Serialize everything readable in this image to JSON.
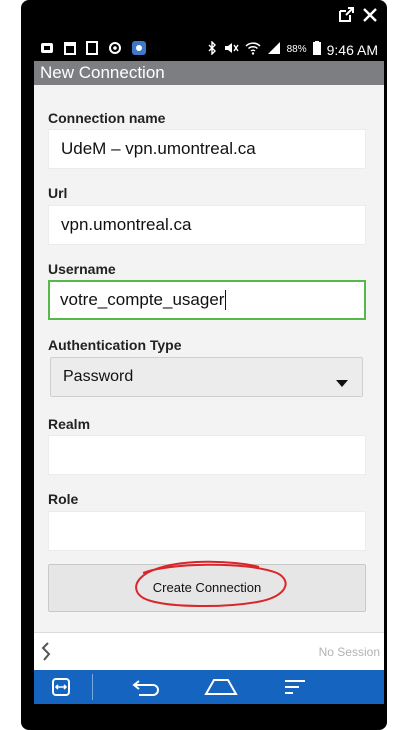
{
  "status_bar": {
    "time": "9:46 AM",
    "battery_percent": "88%"
  },
  "header": {
    "title": "New Connection"
  },
  "form": {
    "connection_name": {
      "label": "Connection name",
      "value": "UdeM – vpn.umontreal.ca"
    },
    "url": {
      "label": "Url",
      "value": "vpn.umontreal.ca"
    },
    "username": {
      "label": "Username",
      "value": "votre_compte_usager"
    },
    "authentication_type": {
      "label": "Authentication Type",
      "selected": "Password"
    },
    "realm": {
      "label": "Realm",
      "value": ""
    },
    "role": {
      "label": "Role",
      "value": ""
    },
    "create_button_label": "Create Connection"
  },
  "session": {
    "status": "No Session"
  },
  "colors": {
    "header_bg": "#7c7e81",
    "nav_bg": "#1565c0",
    "active_field_border": "#57b84a",
    "annotation_circle": "#d9262a"
  },
  "icons": {
    "corner": [
      "external-link-icon",
      "close-icon"
    ],
    "status_left": [
      "notification-icon",
      "calendar-icon",
      "screen-icon",
      "sync-icon",
      "app-icon"
    ],
    "status_right": [
      "bluetooth-icon",
      "mute-icon",
      "wifi-icon",
      "signal-icon",
      "battery-icon"
    ],
    "navbar": [
      "vpn-app-icon",
      "back-icon",
      "home-icon",
      "recent-apps-icon"
    ]
  }
}
